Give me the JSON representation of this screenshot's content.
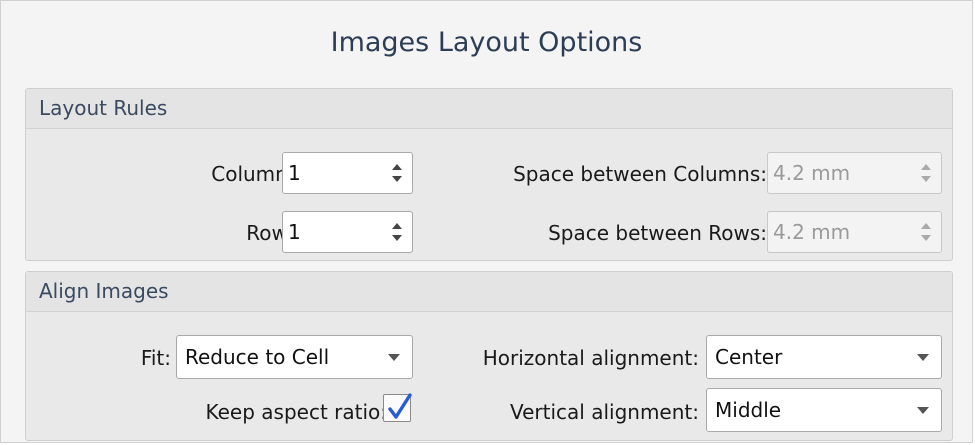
{
  "dialog": {
    "title": "Images Layout Options"
  },
  "layout_rules": {
    "header": "Layout Rules",
    "columns": {
      "label": "Columns:",
      "value": "1"
    },
    "rows": {
      "label": "Rows:",
      "value": "1"
    },
    "space_columns": {
      "label": "Space between Columns:",
      "value": "4.2 mm"
    },
    "space_rows": {
      "label": "Space between Rows:",
      "value": "4.2 mm"
    }
  },
  "align_images": {
    "header": "Align Images",
    "fit": {
      "label": "Fit:",
      "value": "Reduce to Cell"
    },
    "keep_aspect": {
      "label": "Keep aspect ratio:",
      "checked": true
    },
    "horizontal": {
      "label": "Horizontal alignment:",
      "value": "Center"
    },
    "vertical": {
      "label": "Vertical alignment:",
      "value": "Middle"
    }
  },
  "colors": {
    "title": "#2c3e55",
    "panel_header": "#3a4a60",
    "checkmark": "#2a5bd7"
  },
  "icons": {
    "spinner": "up-down-arrows-icon",
    "dropdown": "chevron-down-icon",
    "check": "checkmark-icon"
  }
}
